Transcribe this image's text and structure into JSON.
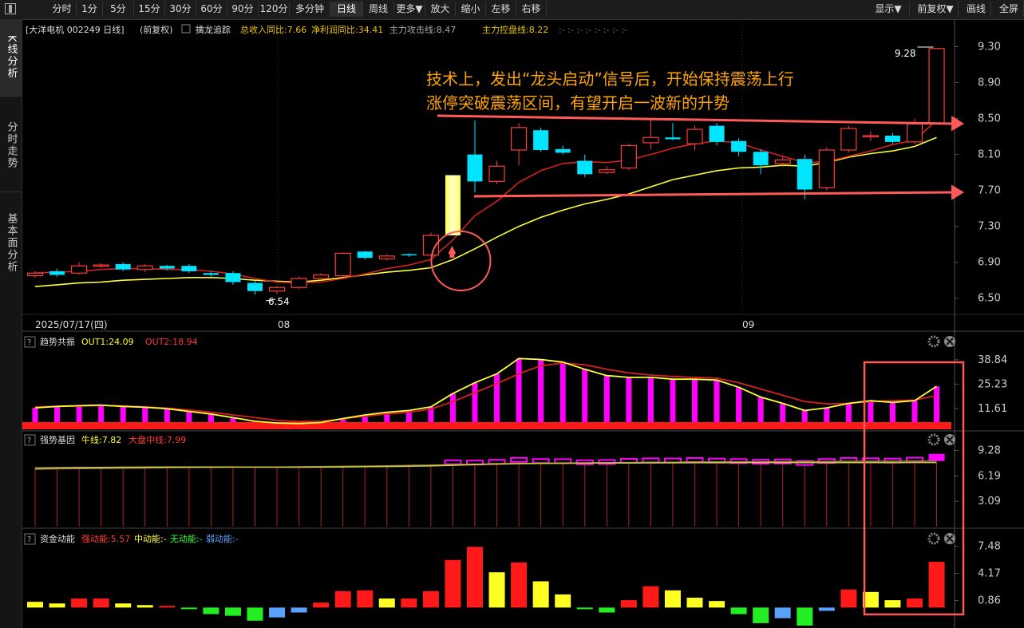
{
  "toolbar": {
    "periods": [
      "分时",
      "1分",
      "5分",
      "15分",
      "30分",
      "60分",
      "90分",
      "120分",
      "多分钟",
      "日线",
      "周线",
      "更多▼",
      "放大",
      "缩小",
      "左移",
      "右移"
    ],
    "active_period": "日线",
    "right_items": [
      "显示▼",
      "前复权▼",
      "画线",
      "全屏"
    ]
  },
  "sidebar": {
    "tabs": [
      "K线分析",
      "分时走势",
      "基本面分析"
    ],
    "active": "K线分析"
  },
  "header": {
    "stock": "[大洋电机 002249 日线]",
    "adjust": "(前复权)",
    "indicator": "擒龙追踪",
    "revenue": "总收入同比:7.66",
    "profit": "净利润同比:34.41",
    "attack": "主力攻击线:8.47",
    "control": "主力控盘线:8.22",
    "marks": ":- :- :- :- :- :- :- :-"
  },
  "annotation": {
    "line1": "技术上，发出“龙头启动”信号后，开始保持震荡上行",
    "line2": "涨停突破震荡区间，有望开启一波新的升势",
    "high_label": "9.28",
    "low_label": "6.54"
  },
  "date_axis": {
    "start": "2025/07/17(四)",
    "m1": "08",
    "m2": "09"
  },
  "panels": {
    "p1": {
      "q": "?",
      "name": "趋势共振",
      "v1": "OUT1:24.09",
      "v2": "OUT2:18.94"
    },
    "p2": {
      "q": "?",
      "name": "强势基因",
      "v1": "牛线:7.82",
      "v2": "大盘中线:7.99"
    },
    "p3": {
      "q": "?",
      "name": "资金动能",
      "v1": "强动能:5.57",
      "v2": "中动能:-",
      "v3": "无动能:-",
      "v4": "弱动能:-"
    }
  },
  "colors": {
    "up": "#ff3b3b",
    "down": "#00e5ff",
    "ma_yellow": "#ffff33",
    "ma_red": "#d62020",
    "magenta": "#ff00ff",
    "annotation": "#ffa500",
    "arrow": "#ff5a5a",
    "axis": "#555555"
  },
  "chart_data": [
    {
      "type": "candlestick",
      "title": "",
      "ylim": [
        6.4,
        9.5
      ],
      "y_ticks": [
        "9.30",
        "8.90",
        "8.50",
        "8.10",
        "7.70",
        "7.30",
        "6.90",
        "6.50"
      ],
      "candles": [
        {
          "o": 6.75,
          "c": 6.78,
          "h": 6.8,
          "l": 6.73
        },
        {
          "o": 6.8,
          "c": 6.76,
          "h": 6.83,
          "l": 6.74
        },
        {
          "o": 6.78,
          "c": 6.86,
          "h": 6.9,
          "l": 6.76
        },
        {
          "o": 6.86,
          "c": 6.87,
          "h": 6.89,
          "l": 6.84
        },
        {
          "o": 6.88,
          "c": 6.82,
          "h": 6.9,
          "l": 6.8
        },
        {
          "o": 6.82,
          "c": 6.86,
          "h": 6.88,
          "l": 6.79
        },
        {
          "o": 6.86,
          "c": 6.83,
          "h": 6.87,
          "l": 6.81
        },
        {
          "o": 6.86,
          "c": 6.8,
          "h": 6.88,
          "l": 6.78
        },
        {
          "o": 6.78,
          "c": 6.76,
          "h": 6.8,
          "l": 6.74
        },
        {
          "o": 6.78,
          "c": 6.68,
          "h": 6.8,
          "l": 6.65
        },
        {
          "o": 6.67,
          "c": 6.58,
          "h": 6.7,
          "l": 6.54
        },
        {
          "o": 6.58,
          "c": 6.62,
          "h": 6.64,
          "l": 6.55
        },
        {
          "o": 6.62,
          "c": 6.72,
          "h": 6.74,
          "l": 6.6
        },
        {
          "o": 6.72,
          "c": 6.76,
          "h": 6.78,
          "l": 6.7
        },
        {
          "o": 6.75,
          "c": 7.0,
          "h": 7.01,
          "l": 6.74
        },
        {
          "o": 7.02,
          "c": 6.95,
          "h": 7.03,
          "l": 6.93
        },
        {
          "o": 6.94,
          "c": 6.97,
          "h": 6.99,
          "l": 6.92
        },
        {
          "o": 6.99,
          "c": 6.98,
          "h": 7.0,
          "l": 6.96
        },
        {
          "o": 6.98,
          "c": 7.2,
          "h": 7.23,
          "l": 6.97
        },
        {
          "o": 7.2,
          "c": 7.87,
          "h": 7.87,
          "l": 7.2
        },
        {
          "o": 8.1,
          "c": 7.8,
          "h": 8.48,
          "l": 7.68
        },
        {
          "o": 7.8,
          "c": 7.97,
          "h": 8.03,
          "l": 7.77
        },
        {
          "o": 8.15,
          "c": 8.4,
          "h": 8.45,
          "l": 7.98
        },
        {
          "o": 8.37,
          "c": 8.15,
          "h": 8.4,
          "l": 8.13
        },
        {
          "o": 8.16,
          "c": 8.12,
          "h": 8.2,
          "l": 8.1
        },
        {
          "o": 8.03,
          "c": 7.88,
          "h": 8.1,
          "l": 7.85
        },
        {
          "o": 7.9,
          "c": 7.93,
          "h": 7.97,
          "l": 7.88
        },
        {
          "o": 7.95,
          "c": 8.2,
          "h": 8.22,
          "l": 7.93
        },
        {
          "o": 8.23,
          "c": 8.29,
          "h": 8.5,
          "l": 8.16
        },
        {
          "o": 8.29,
          "c": 8.27,
          "h": 8.45,
          "l": 8.26
        },
        {
          "o": 8.22,
          "c": 8.38,
          "h": 8.42,
          "l": 8.15
        },
        {
          "o": 8.42,
          "c": 8.24,
          "h": 8.45,
          "l": 8.2
        },
        {
          "o": 8.25,
          "c": 8.13,
          "h": 8.28,
          "l": 8.08
        },
        {
          "o": 8.13,
          "c": 7.98,
          "h": 8.16,
          "l": 7.88
        },
        {
          "o": 8.0,
          "c": 8.04,
          "h": 8.08,
          "l": 7.96
        },
        {
          "o": 8.05,
          "c": 7.71,
          "h": 8.1,
          "l": 7.6
        },
        {
          "o": 7.73,
          "c": 8.15,
          "h": 8.18,
          "l": 7.7
        },
        {
          "o": 8.15,
          "c": 8.39,
          "h": 8.42,
          "l": 8.12
        },
        {
          "o": 8.3,
          "c": 8.31,
          "h": 8.36,
          "l": 8.25
        },
        {
          "o": 8.31,
          "c": 8.24,
          "h": 8.34,
          "l": 8.22
        },
        {
          "o": 8.24,
          "c": 8.44,
          "h": 8.5,
          "l": 8.22
        },
        {
          "o": 8.44,
          "c": 9.28,
          "h": 9.28,
          "l": 8.44
        }
      ],
      "ma_yellow": [
        6.63,
        6.65,
        6.67,
        6.68,
        6.7,
        6.71,
        6.72,
        6.73,
        6.73,
        6.72,
        6.7,
        6.69,
        6.68,
        6.7,
        6.73,
        6.76,
        6.79,
        6.81,
        6.84,
        6.93,
        7.05,
        7.18,
        7.3,
        7.4,
        7.48,
        7.55,
        7.6,
        7.66,
        7.74,
        7.82,
        7.87,
        7.92,
        7.95,
        7.96,
        7.98,
        7.97,
        8.01,
        8.07,
        8.11,
        8.14,
        8.19,
        8.29
      ],
      "ma_red": [
        6.78,
        6.79,
        6.8,
        6.82,
        6.83,
        6.83,
        6.82,
        6.82,
        6.8,
        6.77,
        6.72,
        6.68,
        6.67,
        6.68,
        6.72,
        6.77,
        6.83,
        6.87,
        6.93,
        7.15,
        7.42,
        7.58,
        7.79,
        7.92,
        8.0,
        8.02,
        8.01,
        8.04,
        8.1,
        8.17,
        8.22,
        8.25,
        8.23,
        8.15,
        8.08,
        8.01,
        8.02,
        8.08,
        8.14,
        8.21,
        8.26,
        8.48
      ]
    },
    {
      "type": "bar",
      "title": "趋势共振",
      "ylim": [
        0,
        45
      ],
      "y_ticks": [
        "38.84",
        "25.23",
        "11.61"
      ],
      "series": [
        {
          "name": "OUT1",
          "values": [
            12.0,
            12.8,
            13.2,
            13.5,
            12.8,
            12.3,
            11.5,
            10.0,
            8.5,
            6.5,
            4.5,
            3.5,
            3.2,
            3.8,
            6.0,
            8.0,
            9.5,
            10.5,
            12.5,
            20.0,
            26.0,
            31.0,
            39.5,
            39.0,
            37.5,
            33.5,
            30.0,
            29.0,
            29.0,
            28.0,
            28.0,
            27.5,
            23.5,
            18.0,
            14.5,
            10.5,
            12.0,
            14.5,
            16.0,
            15.0,
            16.0,
            24.0
          ]
        },
        {
          "name": "OUT2",
          "values": [
            12.5,
            12.8,
            13.0,
            13.3,
            13.0,
            12.5,
            11.8,
            10.8,
            9.5,
            8.0,
            6.5,
            5.0,
            4.3,
            4.5,
            5.8,
            7.3,
            8.5,
            9.6,
            11.2,
            15.5,
            20.5,
            25.5,
            31.0,
            35.5,
            37.0,
            36.0,
            33.5,
            31.5,
            30.3,
            29.5,
            29.0,
            28.5,
            26.0,
            22.5,
            19.0,
            15.5,
            14.2,
            14.5,
            15.5,
            16.0,
            16.3,
            18.9
          ]
        }
      ]
    },
    {
      "type": "bar",
      "title": "强势基因",
      "ylim": [
        0,
        10.5
      ],
      "y_ticks": [
        "9.28",
        "6.19",
        "3.09"
      ],
      "series": [
        {
          "name": "牛线",
          "values": [
            7.15,
            7.18,
            7.2,
            7.22,
            7.24,
            7.25,
            7.26,
            7.27,
            7.27,
            7.26,
            7.25,
            7.24,
            7.24,
            7.25,
            7.27,
            7.3,
            7.33,
            7.36,
            7.4,
            7.48,
            7.56,
            7.62,
            7.67,
            7.7,
            7.72,
            7.74,
            7.75,
            7.76,
            7.77,
            7.78,
            7.79,
            7.79,
            7.8,
            7.8,
            7.8,
            7.8,
            7.8,
            7.81,
            7.81,
            7.81,
            7.82,
            7.82
          ]
        },
        {
          "name": "大盘中线",
          "values": [
            7.0,
            7.05,
            7.08,
            7.1,
            7.13,
            7.15,
            7.18,
            7.2,
            7.22,
            7.24,
            7.25,
            7.27,
            7.29,
            7.32,
            7.35,
            7.38,
            7.42,
            7.46,
            7.5,
            7.56,
            7.62,
            7.66,
            7.7,
            7.73,
            7.76,
            7.78,
            7.8,
            7.82,
            7.84,
            7.86,
            7.88,
            7.89,
            7.9,
            7.91,
            7.92,
            7.93,
            7.94,
            7.95,
            7.96,
            7.97,
            7.98,
            7.99
          ]
        }
      ]
    },
    {
      "type": "bar",
      "title": "资金动能",
      "ylim": [
        -2.2,
        8.5
      ],
      "y_ticks": [
        "7.48",
        "4.17",
        "0.86"
      ],
      "values": [
        0.7,
        0.5,
        1.1,
        1.1,
        0.5,
        0.3,
        0.2,
        -0.1,
        -0.8,
        -1.0,
        -1.6,
        -1.2,
        -0.6,
        0.6,
        2.0,
        2.1,
        1.1,
        1.1,
        2.0,
        5.8,
        7.4,
        4.3,
        5.5,
        3.2,
        1.6,
        -0.2,
        -0.6,
        0.9,
        2.6,
        2.1,
        1.2,
        0.8,
        -0.8,
        -1.9,
        -1.3,
        -2.2,
        -0.4,
        2.2,
        1.9,
        0.9,
        1.1,
        5.57
      ],
      "colors": [
        "y",
        "y",
        "r",
        "r",
        "y",
        "y",
        "r",
        "g",
        "g",
        "g",
        "g",
        "b",
        "b",
        "r",
        "r",
        "r",
        "y",
        "r",
        "r",
        "r",
        "r",
        "y",
        "r",
        "y",
        "y",
        "g",
        "g",
        "r",
        "r",
        "y",
        "y",
        "y",
        "g",
        "g",
        "b",
        "g",
        "b",
        "r",
        "y",
        "y",
        "r",
        "r"
      ]
    }
  ]
}
